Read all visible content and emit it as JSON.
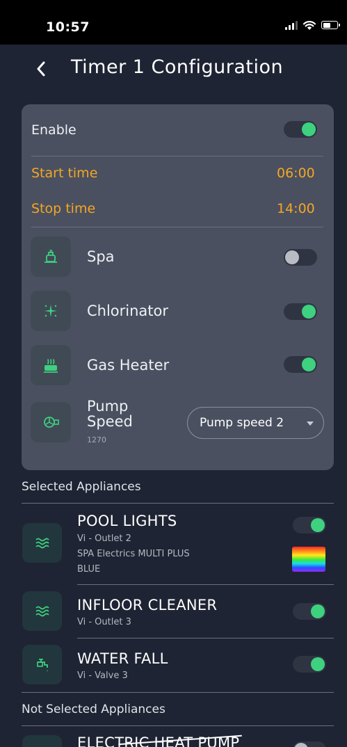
{
  "status_bar": {
    "time": "10:57",
    "icons": [
      "signal-icon",
      "wifi-icon",
      "battery-icon"
    ]
  },
  "header": {
    "title": "Timer 1 Configuration",
    "back_icon": "chevron-left-icon"
  },
  "card": {
    "enable": {
      "label": "Enable",
      "on": true
    },
    "start_time": {
      "label": "Start time",
      "value": "06:00"
    },
    "stop_time": {
      "label": "Stop time",
      "value": "14:00"
    },
    "features": [
      {
        "label": "Spa",
        "icon": "spa-icon",
        "on": false
      },
      {
        "label": "Chlorinator",
        "icon": "sparkle-icon",
        "on": true
      },
      {
        "label": "Gas Heater",
        "icon": "heater-icon",
        "on": true
      }
    ],
    "pump": {
      "label_line1": "Pump",
      "label_line2": "Speed",
      "sub": "1270",
      "icon": "pump-icon",
      "select_value": "Pump speed 2"
    }
  },
  "selected_section": {
    "title": "Selected Appliances",
    "items": [
      {
        "name": "POOL LIGHTS",
        "sub": "Vi - Outlet 2",
        "extra1": "SPA Electrics MULTI PLUS",
        "extra2": "BLUE",
        "icon": "water-waves-icon",
        "on": true
      },
      {
        "name": "INFLOOR CLEANER",
        "sub": "Vi - Outlet 3",
        "icon": "water-waves-icon",
        "on": true
      },
      {
        "name": "WATER FALL",
        "sub": "Vi - Valve 3",
        "icon": "faucet-icon",
        "on": true
      }
    ]
  },
  "not_selected_section": {
    "title": "Not Selected Appliances",
    "items": [
      {
        "name": "ELECTRIC HEAT PUMP",
        "on": false
      }
    ]
  },
  "colors": {
    "accent": "#3ed17f",
    "orange": "#f5a623",
    "background": "#1e2433",
    "card": "#4a5060"
  }
}
